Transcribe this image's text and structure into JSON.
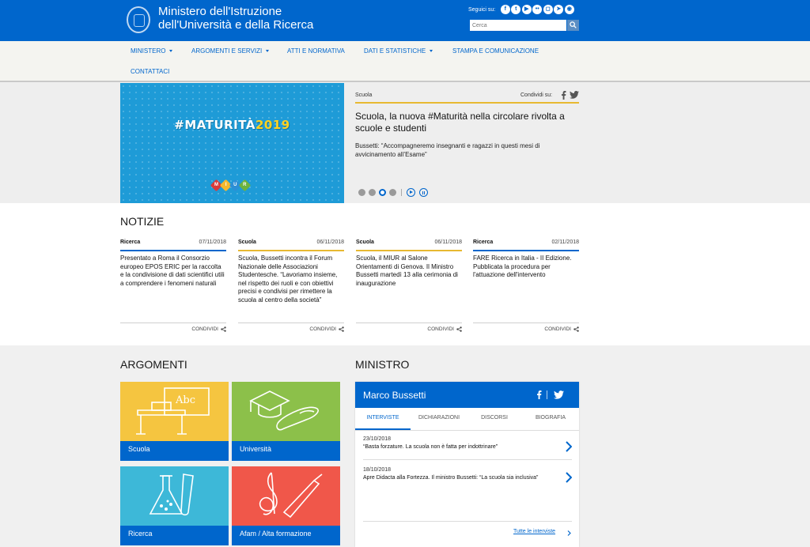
{
  "header": {
    "title_line1": "Ministero dell'Istruzione",
    "title_line2": "dell'Università e della Ricerca",
    "social_label": "Seguici su:",
    "search_placeholder": "Cerca"
  },
  "nav": {
    "items": [
      {
        "label": "MINISTERO",
        "dropdown": true
      },
      {
        "label": "ARGOMENTI E SERVIZI",
        "dropdown": true
      },
      {
        "label": "ATTI E NORMATIVA",
        "dropdown": false
      },
      {
        "label": "DATI E STATISTICHE",
        "dropdown": true
      },
      {
        "label": "STAMPA E COMUNICAZIONE",
        "dropdown": false
      },
      {
        "label": "CONTATTACI",
        "dropdown": false
      }
    ]
  },
  "hero": {
    "image_text": "#MATURITÀ",
    "image_year": "2019",
    "badges": [
      "M",
      "I",
      "U",
      "R"
    ],
    "category": "Scuola",
    "share_label": "Condividi su:",
    "title": "Scuola, la nuova #Maturità nella circolare rivolta a scuole e studenti",
    "subtitle": "Bussetti: “Accompagneremo insegnanti e ragazzi in questi mesi di avvicinamento all’Esame”",
    "slide_count": 4,
    "active_slide": 3
  },
  "news": {
    "title": "NOTIZIE",
    "share_label": "CONDIVIDI",
    "items": [
      {
        "category": "Ricerca",
        "date": "07/11/2018",
        "text": "Presentato a Roma il Consorzio europeo EPOS ERIC per la raccolta e la condivisione di dati scientifici utili a comprendere i fenomeni naturali"
      },
      {
        "category": "Scuola",
        "date": "06/11/2018",
        "text": "Scuola, Bussetti incontra il Forum Nazionale delle Associazioni Studentesche. “Lavoriamo insieme, nel rispetto dei ruoli e con obiettivi precisi e condivisi per rimettere la scuola al centro della società”"
      },
      {
        "category": "Scuola",
        "date": "06/11/2018",
        "text": "Scuola, il MIUR al Salone Orientamenti di Genova. Il Ministro Bussetti martedì 13 alla cerimonia di inaugurazione"
      },
      {
        "category": "Ricerca",
        "date": "02/11/2018",
        "text": "FARE Ricerca in Italia - II Edizione. Pubblicata la procedura per l'attuazione dell'intervento"
      }
    ]
  },
  "argomenti": {
    "title": "ARGOMENTI",
    "tiles": [
      {
        "label": "Scuola",
        "color": "#f5c540",
        "icon": "school-desk-icon"
      },
      {
        "label": "Università",
        "color": "#8cc04a",
        "icon": "graduation-cap-icon"
      },
      {
        "label": "Ricerca",
        "color": "#3db8d8",
        "icon": "lab-flask-icon"
      },
      {
        "label": "Afam / Alta formazione",
        "color": "#f0574a",
        "icon": "music-art-icon"
      }
    ]
  },
  "ministro": {
    "title": "MINISTRO",
    "name": "Marco Bussetti",
    "tabs": [
      "INTERVISTE",
      "DICHIARAZIONI",
      "DISCORSI",
      "BIOGRAFIA"
    ],
    "active_tab": "INTERVISTE",
    "interviews": [
      {
        "date": "23/10/2018",
        "text": "“Basta forzature. La scuola non è fatta per indottrinare”"
      },
      {
        "date": "18/10/2018",
        "text": "Apre Didacta alla Fortezza. Il ministro Bussetti: “La scuola sia inclusiva”"
      }
    ],
    "all_link": "Tutte le interviste"
  },
  "colors": {
    "primary": "#0066cc",
    "ricerca_accent": "#0066cc",
    "scuola_accent": "#e7b931"
  }
}
